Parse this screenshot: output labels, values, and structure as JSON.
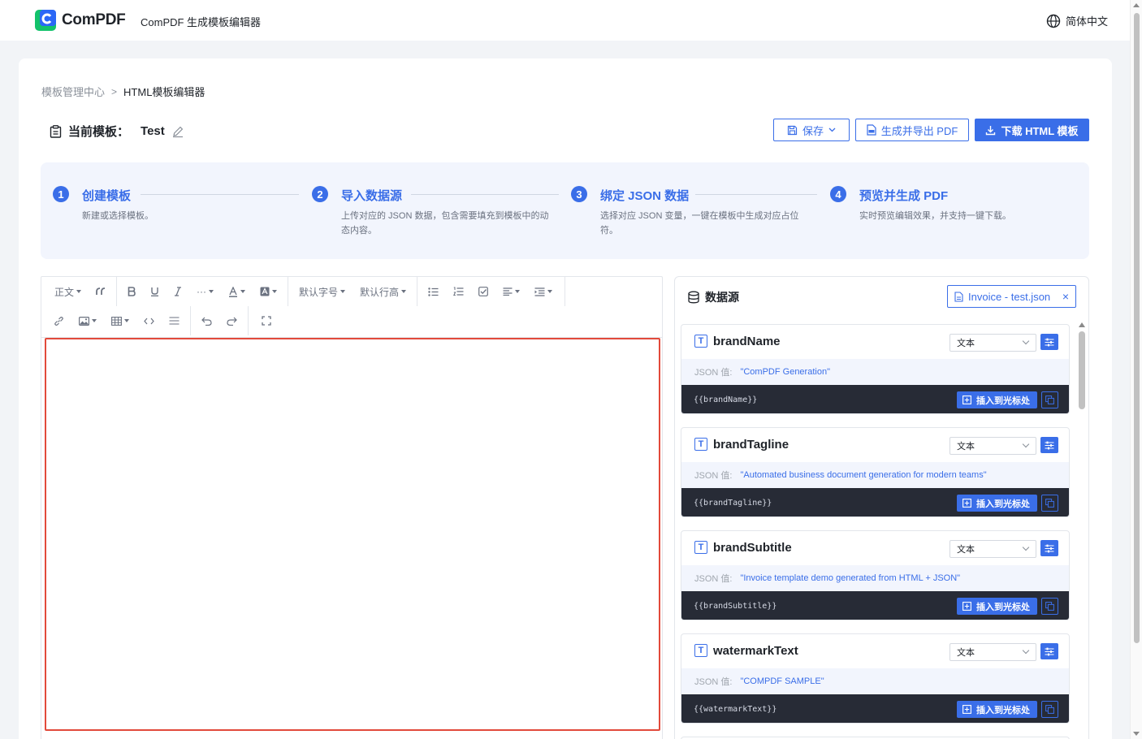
{
  "header": {
    "brand": "ComPDF",
    "app_title": "ComPDF 生成模板编辑器",
    "language": "简体中文",
    "icons": {
      "logo": "compdf-logo-icon",
      "language": "globe-icon"
    },
    "colors": {
      "accent": "#3a6ee8",
      "logo_green": "#13c26b",
      "logo_blue": "#2b67f6"
    }
  },
  "breadcrumb": {
    "parent": "模板管理中心",
    "separator": ">",
    "current": "HTML模板编辑器"
  },
  "current_template": {
    "label": "当前模板：",
    "name": "Test"
  },
  "actions": {
    "save": "保存",
    "export_pdf": "生成并导出 PDF",
    "download_html": "下载 HTML 模板"
  },
  "steps": [
    {
      "num": "1",
      "title": "创建模板",
      "desc": "新建或选择模板。"
    },
    {
      "num": "2",
      "title": "导入数据源",
      "desc": "上传对应的 JSON 数据，包含需要填充到模板中的动态内容。"
    },
    {
      "num": "3",
      "title": "绑定 JSON 数据",
      "desc": "选择对应 JSON 变量，一键在模板中生成对应占位符。"
    },
    {
      "num": "4",
      "title": "预览并生成 PDF",
      "desc": "实时预览编辑效果，并支持一键下载。"
    }
  ],
  "toolbar": {
    "paragraph": "正文",
    "font_size": "默认字号",
    "line_height": "默认行高"
  },
  "data_source": {
    "title": "数据源",
    "file": "Invoice - test.json",
    "json_label": "JSON 值:",
    "type_option": "文本",
    "insert_label": "插入到光标处",
    "fields": [
      {
        "name": "brandName",
        "value": "\"ComPDF Generation\"",
        "placeholder": "{{brandName}}"
      },
      {
        "name": "brandTagline",
        "value": "\"Automated business document generation for modern teams\"",
        "placeholder": "{{brandTagline}}"
      },
      {
        "name": "brandSubtitle",
        "value": "\"Invoice template demo generated from HTML + JSON\"",
        "placeholder": "{{brandSubtitle}}"
      },
      {
        "name": "watermarkText",
        "value": "\"COMPDF SAMPLE\"",
        "placeholder": "{{watermarkText}}"
      }
    ]
  }
}
